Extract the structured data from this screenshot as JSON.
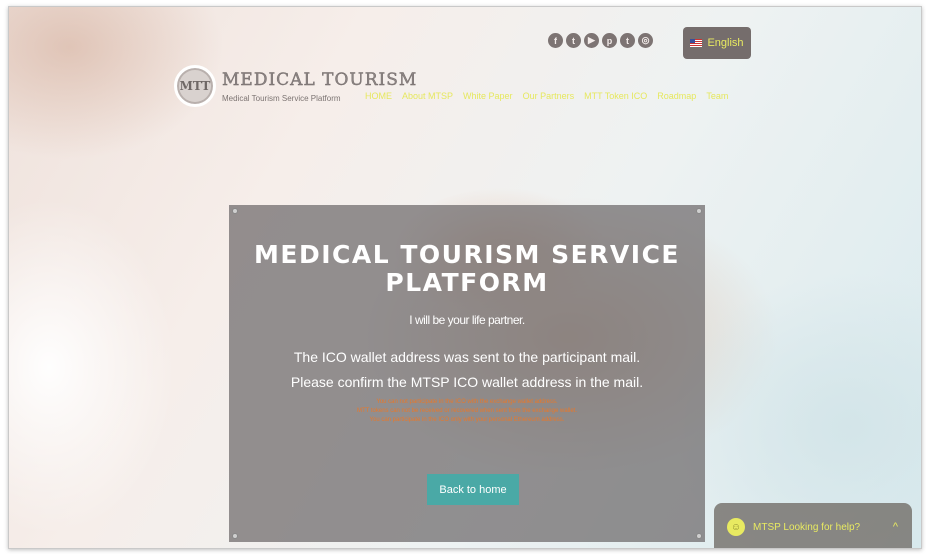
{
  "brand": {
    "badge": "MTT",
    "title": "MEDICAL TOURISM",
    "subtitle": "Medical Tourism Service Platform"
  },
  "nav": {
    "items": [
      {
        "label": "HOME"
      },
      {
        "label": "About MTSP"
      },
      {
        "label": "White Paper"
      },
      {
        "label": "Our Partners"
      },
      {
        "label": "MTT Token ICO"
      },
      {
        "label": "Roadmap"
      },
      {
        "label": "Team"
      }
    ]
  },
  "social": {
    "icons": [
      {
        "name": "facebook-icon",
        "glyph": "f"
      },
      {
        "name": "twitter-icon",
        "glyph": "t"
      },
      {
        "name": "youtube-icon",
        "glyph": "▶"
      },
      {
        "name": "pinterest-icon",
        "glyph": "p"
      },
      {
        "name": "tumblr-icon",
        "glyph": "t"
      },
      {
        "name": "instagram-icon",
        "glyph": "◎"
      }
    ]
  },
  "language": {
    "label": "English"
  },
  "hero": {
    "title_line1": "MEDICAL TOURISM SERVICE",
    "title_line2": "PLATFORM",
    "tagline": "I will be your life partner.",
    "message_line1": "The ICO wallet address was sent to the participant mail.",
    "message_line2": "Please confirm the MTSP ICO wallet address in the mail.",
    "notice_line1": "You can not participate in the ICO with the exchange wallet address.",
    "notice_line2": "MTT tokens can not be received or recovered when sent from the exchange wallet.",
    "notice_line3": "You can participate in the ICO only with your personal Ethereum address.",
    "back_button": "Back to home"
  },
  "help_widget": {
    "label": "MTSP Looking for help?",
    "face": "☺",
    "chevron": "^"
  },
  "colors": {
    "accent_yellow": "#e8ea61",
    "button_teal": "#4aa9a6",
    "notice_orange": "#e8782a",
    "panel_gray": "#6c686a"
  }
}
